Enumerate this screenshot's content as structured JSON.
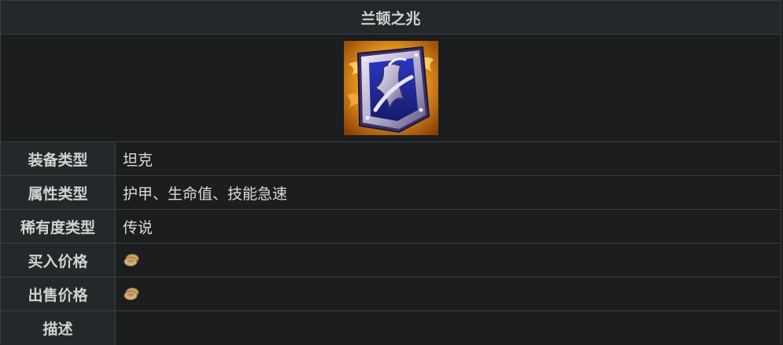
{
  "title": "兰顿之兆",
  "item_image": {
    "icon": "randuins-omen-shield-icon",
    "colors": {
      "glow": "#f0a020",
      "shield_dark": "#3c2f6a",
      "shield_blue": "#2a33b8",
      "metal": "#c8c4d8"
    }
  },
  "rows": [
    {
      "label": "装备类型",
      "value": "坦克"
    },
    {
      "label": "属性类型",
      "value": "护甲、生命值、技能急速"
    },
    {
      "label": "稀有度类型",
      "value": "传说"
    },
    {
      "label": "买入价格",
      "icon": "gold-coin-icon"
    },
    {
      "label": "出售价格",
      "icon": "gold-coin-icon"
    },
    {
      "label": "描述",
      "value": ""
    }
  ],
  "colors": {
    "header_bg": "#23292a",
    "body_bg": "#1b1d1e",
    "border": "#3a3e40",
    "coin": "#c9a36a"
  }
}
